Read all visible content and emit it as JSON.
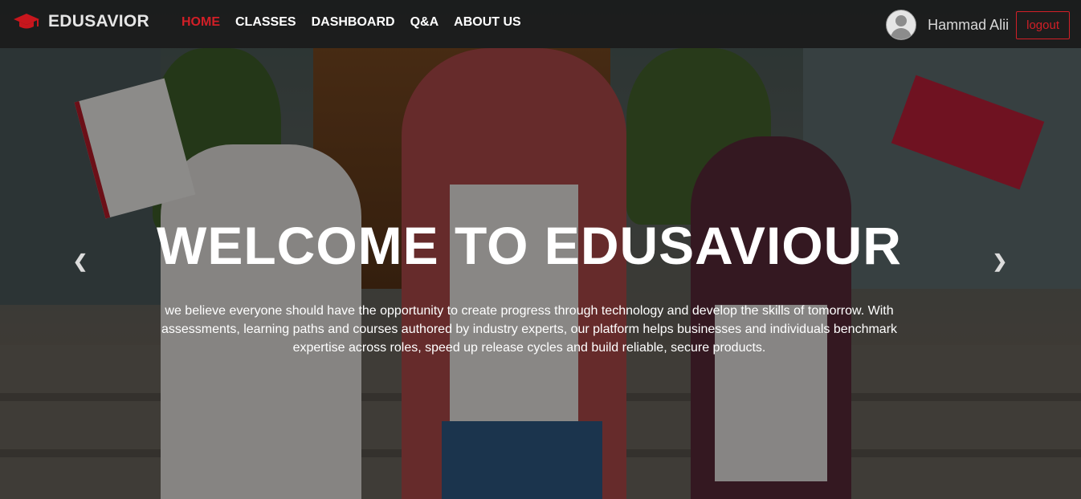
{
  "navbar": {
    "brand": "EDUSAVIOR",
    "icon": "graduation-cap-icon",
    "links": [
      "HOME",
      "CLASSES",
      "DASHBOARD",
      "Q&A",
      "ABOUT US"
    ],
    "active_link": "HOME",
    "user": {
      "name": "Hammad Alii",
      "avatar_icon": "user-avatar-icon",
      "logout_label": "logout"
    }
  },
  "hero": {
    "title": "WELCOME TO EDUSAVIOUR",
    "description": "we believe everyone should have the opportunity to create progress through technology and develop the skills of tomorrow. With assessments, learning paths and courses authored by industry experts, our platform helps businesses and individuals benchmark expertise across roles, speed up release cycles and build reliable, secure products.",
    "prev_icon": "chevron-left-icon",
    "next_icon": "chevron-right-icon"
  },
  "colors": {
    "accent": "#d21f27",
    "navbar_bg": "#191919",
    "text": "#ffffff"
  }
}
